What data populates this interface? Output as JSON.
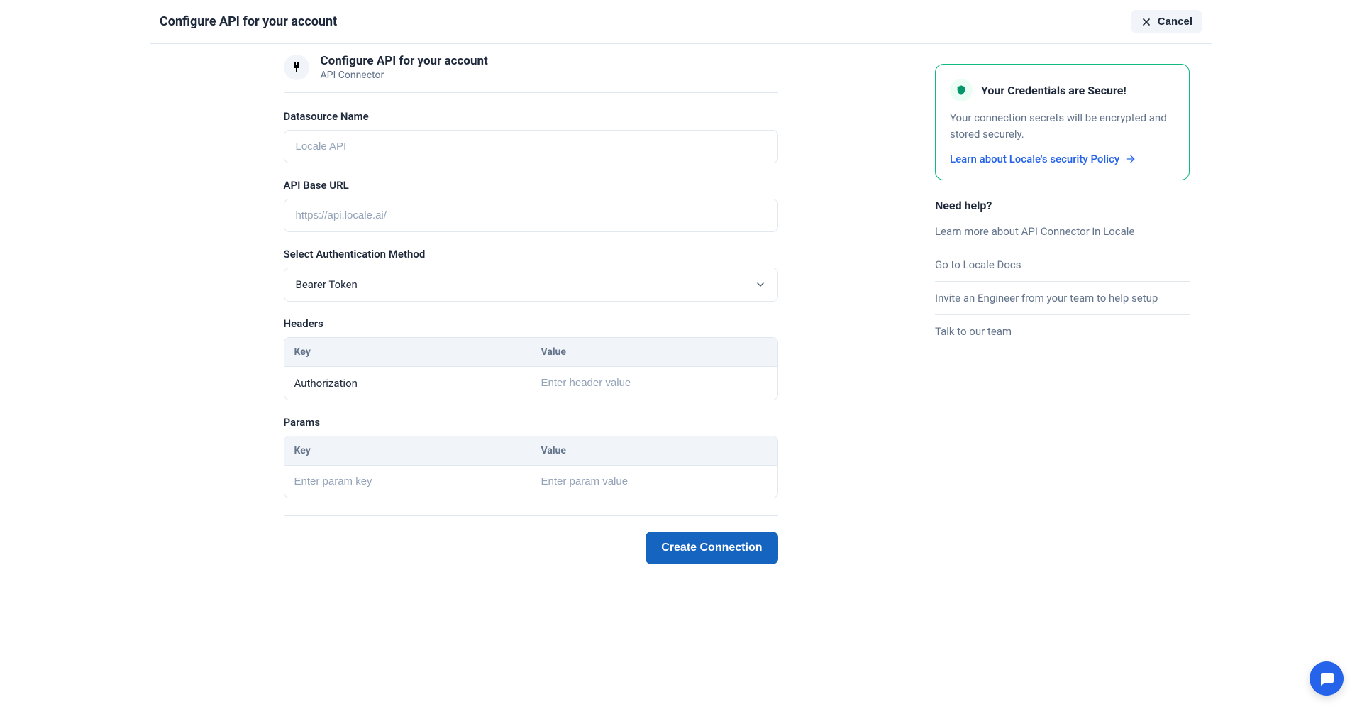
{
  "header": {
    "title": "Configure API for your account",
    "cancel_label": "Cancel"
  },
  "section": {
    "title": "Configure API for your account",
    "subtitle": "API Connector"
  },
  "form": {
    "datasource_label": "Datasource Name",
    "datasource_placeholder": "Locale API",
    "datasource_value": "",
    "base_url_label": "API Base URL",
    "base_url_placeholder": "https://api.locale.ai/",
    "base_url_value": "",
    "auth_label": "Select Authentication Method",
    "auth_selected": "Bearer Token",
    "headers_label": "Headers",
    "headers_columns": {
      "key": "Key",
      "value": "Value"
    },
    "headers_rows": [
      {
        "key": "Authorization",
        "value_placeholder": "Enter header value",
        "value": ""
      }
    ],
    "params_label": "Params",
    "params_columns": {
      "key": "Key",
      "value": "Value"
    },
    "params_rows": [
      {
        "key_placeholder": "Enter param key",
        "key": "",
        "value_placeholder": "Enter param value",
        "value": ""
      }
    ],
    "submit_label": "Create Connection"
  },
  "sidebar": {
    "secure": {
      "title": "Your Credentials are Secure!",
      "desc": "Your connection secrets will be encrypted and stored securely.",
      "link": "Learn about Locale's security Policy"
    },
    "help_title": "Need help?",
    "help_links": [
      "Learn more about API Connector in Locale",
      "Go to Locale Docs",
      "Invite an Engineer from your team to help setup",
      "Talk to our team"
    ]
  }
}
